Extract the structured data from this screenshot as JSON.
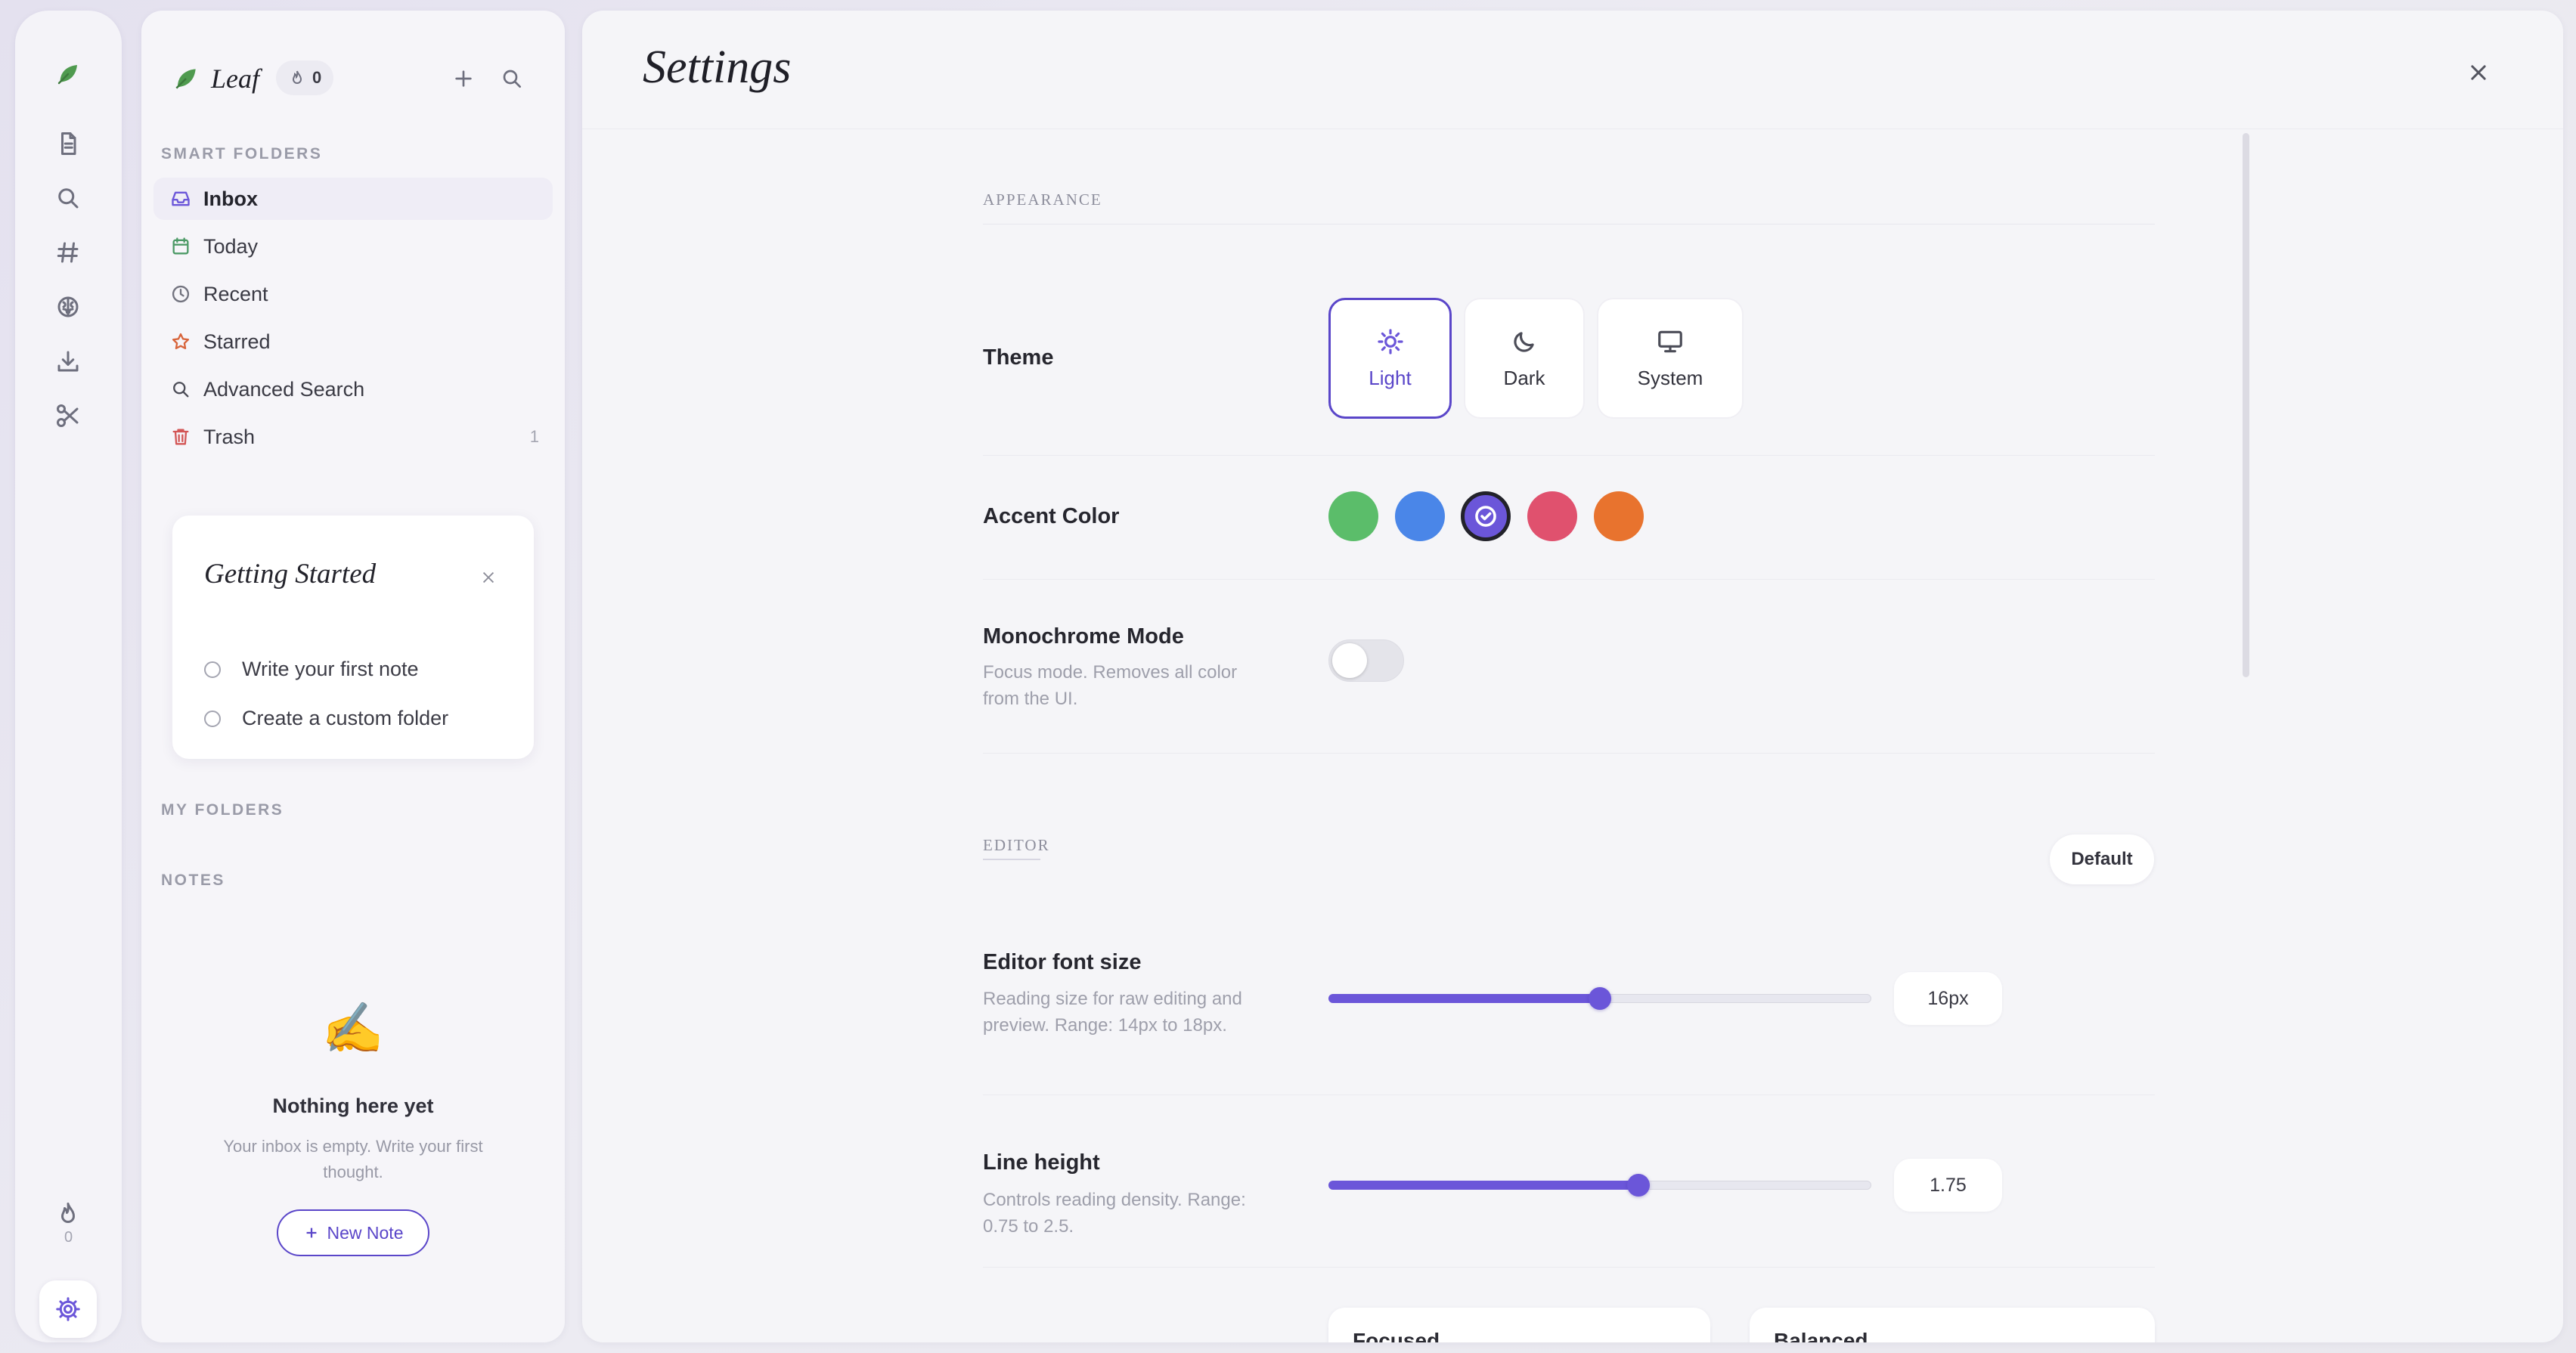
{
  "app": {
    "name": "Leaf",
    "streak_count": "0"
  },
  "rail": {
    "streak_count": "0"
  },
  "sidebar": {
    "smart_folders_label": "SMART FOLDERS",
    "items": [
      {
        "label": "Inbox",
        "icon": "inbox-icon",
        "count": ""
      },
      {
        "label": "Today",
        "icon": "calendar-icon",
        "count": ""
      },
      {
        "label": "Recent",
        "icon": "clock-icon",
        "count": ""
      },
      {
        "label": "Starred",
        "icon": "star-icon",
        "count": ""
      },
      {
        "label": "Advanced Search",
        "icon": "search-icon",
        "count": ""
      },
      {
        "label": "Trash",
        "icon": "trash-icon",
        "count": "1"
      }
    ],
    "getting_started": {
      "title": "Getting Started",
      "tasks": [
        "Write your first note",
        "Create a custom folder"
      ]
    },
    "my_folders_label": "MY FOLDERS",
    "notes_label": "NOTES",
    "empty": {
      "emoji": "✍️",
      "title": "Nothing here yet",
      "subtitle": "Your inbox is empty. Write your first thought.",
      "button": "New Note"
    }
  },
  "settings": {
    "title": "Settings",
    "appearance": {
      "section_label": "APPEARANCE",
      "theme_label": "Theme",
      "themes": [
        {
          "label": "Light",
          "icon": "sun-icon",
          "selected": true
        },
        {
          "label": "Dark",
          "icon": "moon-icon",
          "selected": false
        },
        {
          "label": "System",
          "icon": "monitor-icon",
          "selected": false
        }
      ],
      "accent_label": "Accent Color",
      "accent_colors": [
        {
          "name": "green",
          "hex": "#5bbd6a",
          "selected": false
        },
        {
          "name": "blue",
          "hex": "#4a86e8",
          "selected": false
        },
        {
          "name": "purple",
          "hex": "#6b56d9",
          "selected": true
        },
        {
          "name": "pink",
          "hex": "#e0516e",
          "selected": false
        },
        {
          "name": "orange",
          "hex": "#e8732e",
          "selected": false
        }
      ],
      "monochrome_label": "Monochrome Mode",
      "monochrome_desc": "Focus mode. Removes all color from the UI.",
      "monochrome_on": false
    },
    "editor": {
      "section_label": "EDITOR",
      "default_button": "Default",
      "font_size": {
        "label": "Editor font size",
        "desc": "Reading size for raw editing and preview. Range: 14px to 18px.",
        "value": "16px",
        "min": 14,
        "max": 18,
        "current": 16
      },
      "line_height": {
        "label": "Line height",
        "desc": "Controls reading density. Range: 0.75 to 2.5.",
        "value": "1.75",
        "min": 0.75,
        "max": 2.5,
        "current": 1.75
      },
      "presets": [
        "Focused",
        "Balanced"
      ]
    }
  },
  "colors": {
    "accent": "#6b56d9",
    "accent_dark": "#5a46c9"
  }
}
